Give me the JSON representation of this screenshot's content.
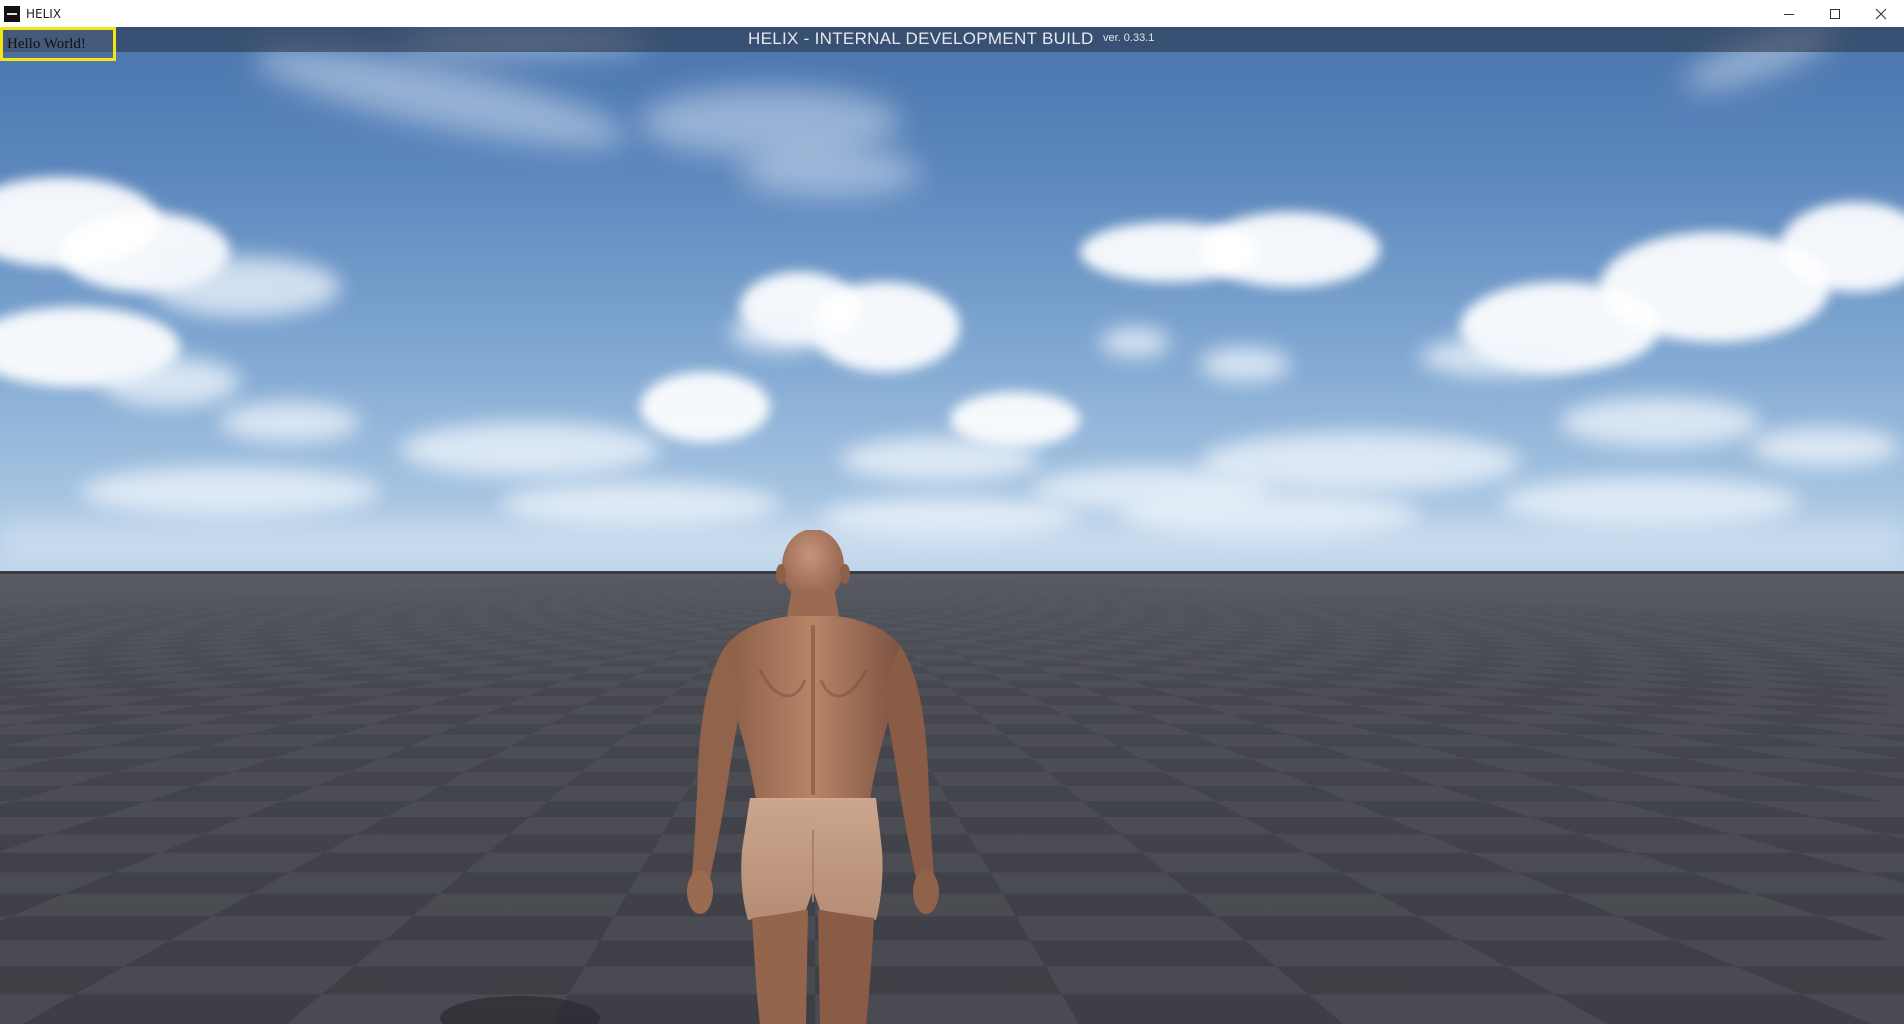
{
  "window": {
    "title": "HELIX",
    "icon": "helix-app-icon",
    "controls": [
      "minimize-icon",
      "maximize-icon",
      "close-icon"
    ]
  },
  "hud": {
    "title": "HELIX - INTERNAL DEVELOPMENT BUILD",
    "version": "ver. 0.33.1",
    "debug_message": "Hello World!"
  },
  "colors": {
    "debug_box_border": "#f4e616",
    "sky_top": "#4a75ad",
    "ground": "#4a4b52"
  }
}
